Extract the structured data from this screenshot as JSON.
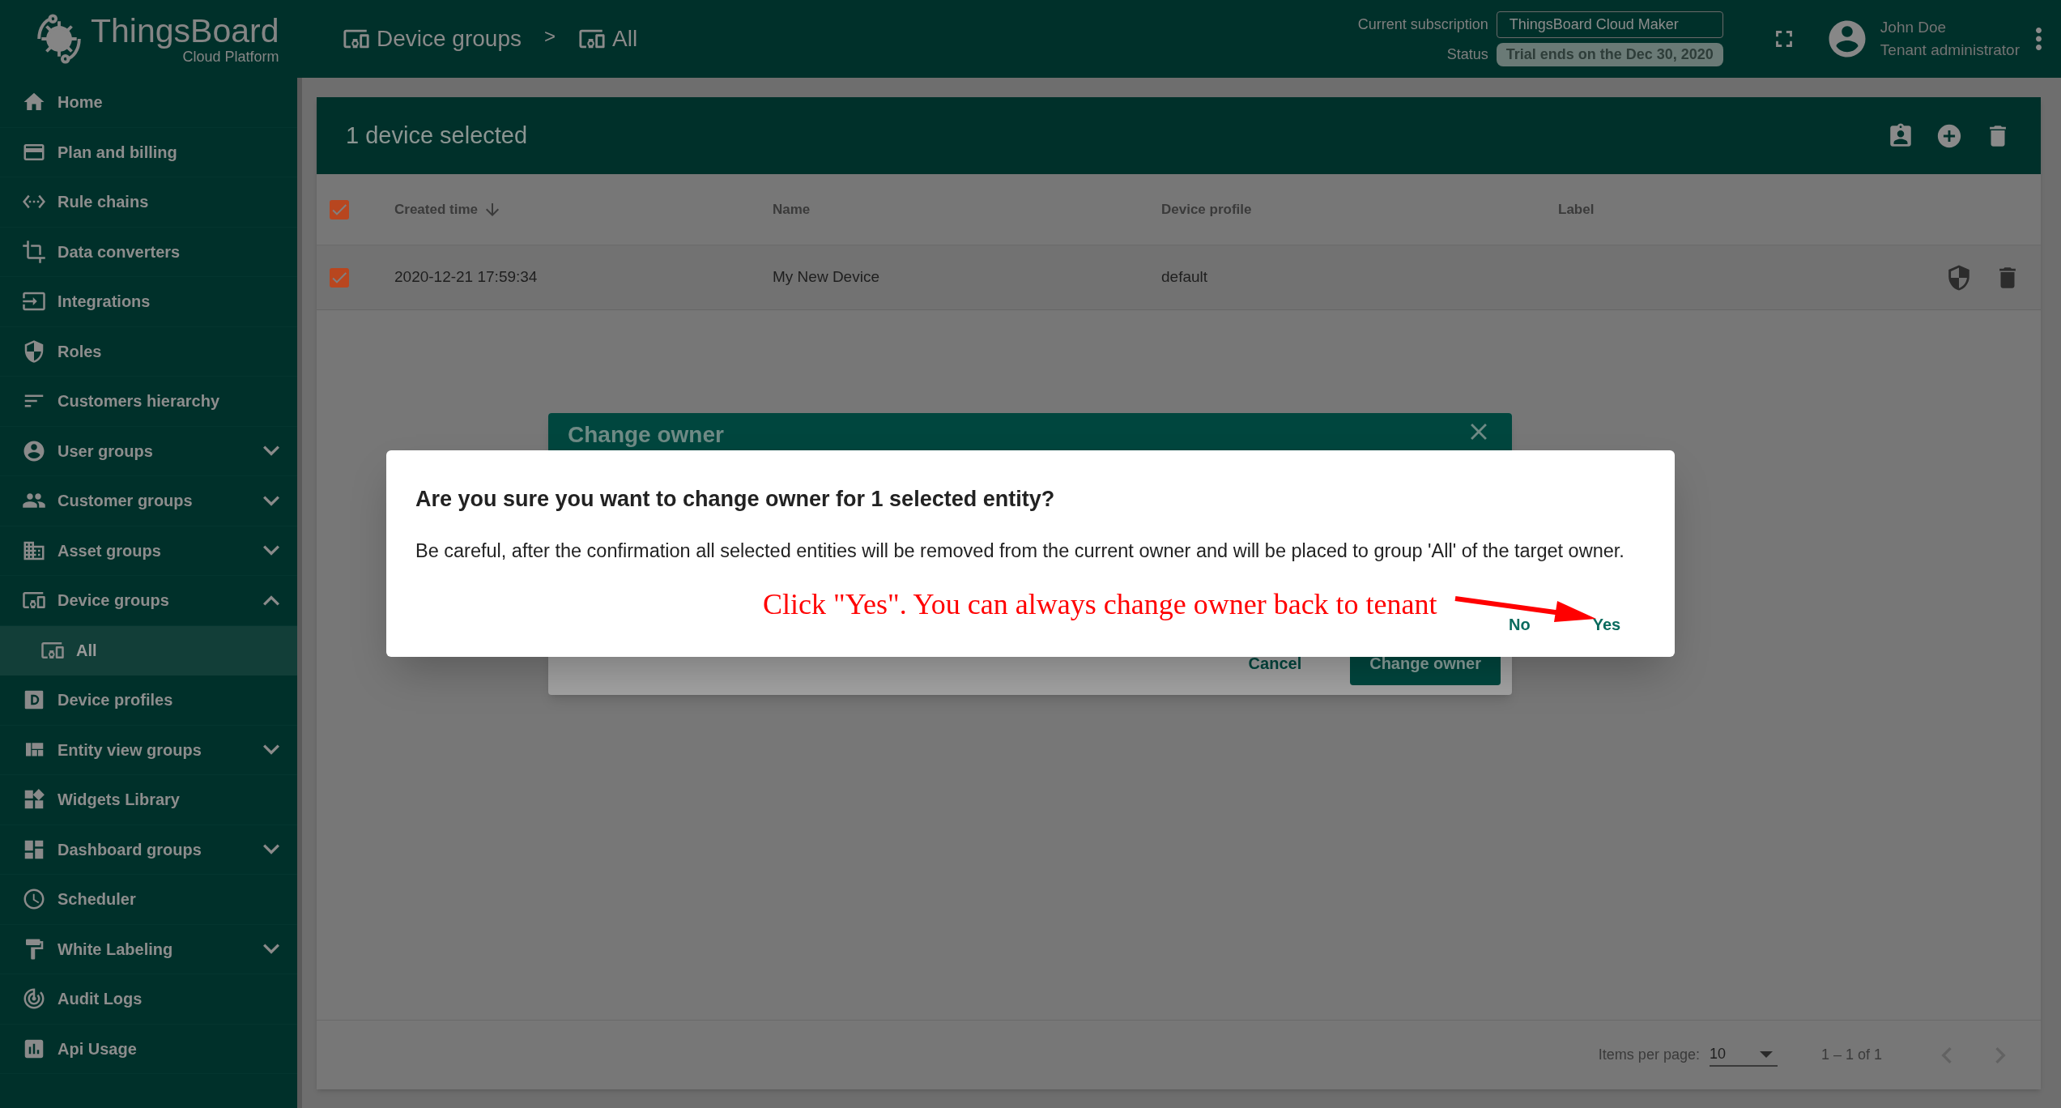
{
  "logo": {
    "title": "ThingsBoard",
    "subtitle": "Cloud Platform"
  },
  "breadcrumb": {
    "separator": ">",
    "items": [
      {
        "label": "Device groups"
      },
      {
        "label": "All"
      }
    ]
  },
  "subscription": {
    "label": "Current subscription",
    "plan": "ThingsBoard Cloud Maker",
    "status_label": "Status",
    "status": "Trial ends on the Dec 30, 2020"
  },
  "user": {
    "name": "John Doe",
    "role": "Tenant administrator"
  },
  "sidebar": {
    "items": [
      {
        "label": "Home",
        "kind": "link",
        "selected": false
      },
      {
        "label": "Plan and billing",
        "kind": "link",
        "selected": false
      },
      {
        "label": "Rule chains",
        "kind": "link",
        "selected": false
      },
      {
        "label": "Data converters",
        "kind": "link",
        "selected": false
      },
      {
        "label": "Integrations",
        "kind": "link",
        "selected": false
      },
      {
        "label": "Roles",
        "kind": "link",
        "selected": false
      },
      {
        "label": "Customers hierarchy",
        "kind": "link",
        "selected": false
      },
      {
        "label": "User groups",
        "kind": "group",
        "expanded": false,
        "selected": false
      },
      {
        "label": "Customer groups",
        "kind": "group",
        "expanded": false,
        "selected": false
      },
      {
        "label": "Asset groups",
        "kind": "group",
        "expanded": false,
        "selected": false
      },
      {
        "label": "Device groups",
        "kind": "group",
        "expanded": true,
        "selected": false,
        "children": [
          {
            "label": "All",
            "selected": true
          }
        ]
      },
      {
        "label": "Device profiles",
        "kind": "link",
        "selected": false
      },
      {
        "label": "Entity view groups",
        "kind": "group",
        "expanded": false,
        "selected": false
      },
      {
        "label": "Widgets Library",
        "kind": "link",
        "selected": false
      },
      {
        "label": "Dashboard groups",
        "kind": "group",
        "expanded": false,
        "selected": false
      },
      {
        "label": "Scheduler",
        "kind": "link",
        "selected": false
      },
      {
        "label": "White Labeling",
        "kind": "group",
        "expanded": false,
        "selected": false
      },
      {
        "label": "Audit Logs",
        "kind": "link",
        "selected": false
      },
      {
        "label": "Api Usage",
        "kind": "link",
        "selected": false
      }
    ]
  },
  "table": {
    "title": "1 device selected",
    "all_checked": true,
    "columns": [
      {
        "label": "Created time",
        "sorted": true
      },
      {
        "label": "Name",
        "sorted": false
      },
      {
        "label": "Device profile",
        "sorted": false
      },
      {
        "label": "Label",
        "sorted": false
      }
    ],
    "rows": [
      {
        "checked": true,
        "cells": [
          "2020-12-21 17:59:34",
          "My New Device",
          "default"
        ]
      }
    ]
  },
  "paginator": {
    "label": "Items per page:",
    "page_size": "10",
    "range": "1 – 1 of 1"
  },
  "change_owner_dialog": {
    "title": "Change owner",
    "buttons": [
      "Cancel",
      "Change owner"
    ]
  },
  "confirm_dialog": {
    "title": "Are you sure you want to change owner for 1 selected entity?",
    "message": "Be careful, after the confirmation all selected entities will be removed from the current owner and will be placed to group 'All' of the target owner.",
    "buttons": [
      "No",
      "Yes"
    ]
  },
  "annotation": {
    "text": "Click \"Yes\". You can always change owner back to tenant"
  }
}
